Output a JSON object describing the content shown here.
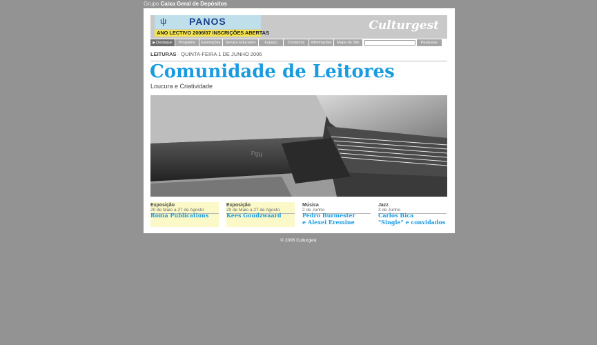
{
  "group": {
    "prefix": "Grupo",
    "name": "Caixa Geral de Depósitos"
  },
  "banner": {
    "title": "PANOS",
    "strip": "ANO LECTIVO 2006/07 INSCRIÇÕES ABERTAS"
  },
  "logo": "Culturgest",
  "nav": {
    "tabs": [
      "Destaque",
      "Programa",
      "Exposições",
      "Serviço Educativo",
      "Espaço",
      "Contactos",
      "Informações",
      "Mapa do Site"
    ],
    "search_placeholder": "",
    "search_button": "Pesquisar"
  },
  "breadcrumb": {
    "section": "LEITURAS",
    "date": " · QUINTA-FEIRA 1 DE JUNHO 2006"
  },
  "headline": "Comunidade de Leitores",
  "subtitle": "Loucura e Criatividade",
  "photo_alt": "",
  "cards": [
    {
      "category": "Exposição",
      "date": "20 de Maio a 27 de Agosto",
      "lines": [
        "Roma Publications"
      ]
    },
    {
      "category": "Exposição",
      "date": "20 de Maio a 27 de Agosto",
      "lines": [
        "Kees Goudzwaard"
      ]
    },
    {
      "category": "Música",
      "date": "2 de Junho",
      "lines": [
        "Pedro Burmester",
        "e Alexei Eremine"
      ]
    },
    {
      "category": "Jazz",
      "date": "3 de Junho",
      "lines": [
        "Carlos Bica",
        "\"Single\" e convidados"
      ]
    }
  ],
  "footer": "© 2006 Culturgest",
  "colors": {
    "background": "#939393",
    "accent": "#1a9be0",
    "highlight": "#fbf9c7",
    "nav": "#a5a5a5"
  }
}
